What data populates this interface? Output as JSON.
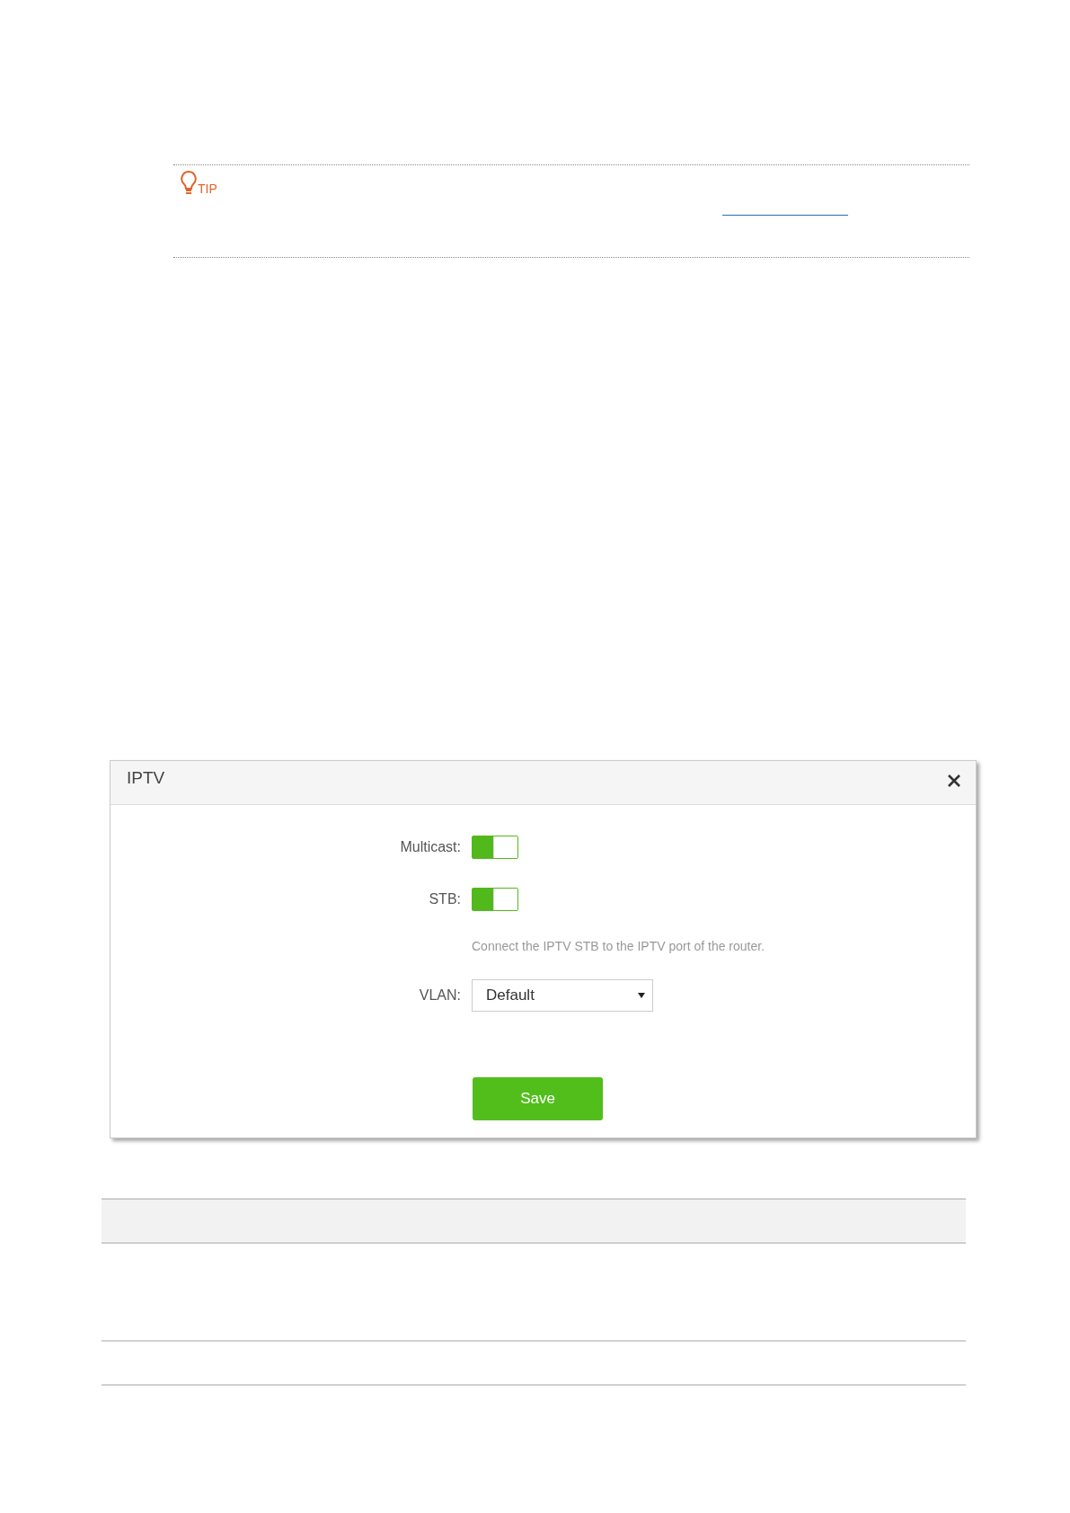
{
  "tip": {
    "label": "TIP"
  },
  "dialog": {
    "title": "IPTV",
    "fields": [
      {
        "kind": "toggle",
        "label": "Multicast:",
        "on": true
      },
      {
        "kind": "toggle",
        "label": "STB:",
        "on": true
      },
      {
        "kind": "hint",
        "text": "Connect the IPTV STB to the IPTV port of the router."
      },
      {
        "kind": "select",
        "label": "VLAN:",
        "value": "Default"
      }
    ],
    "save": "Save"
  }
}
